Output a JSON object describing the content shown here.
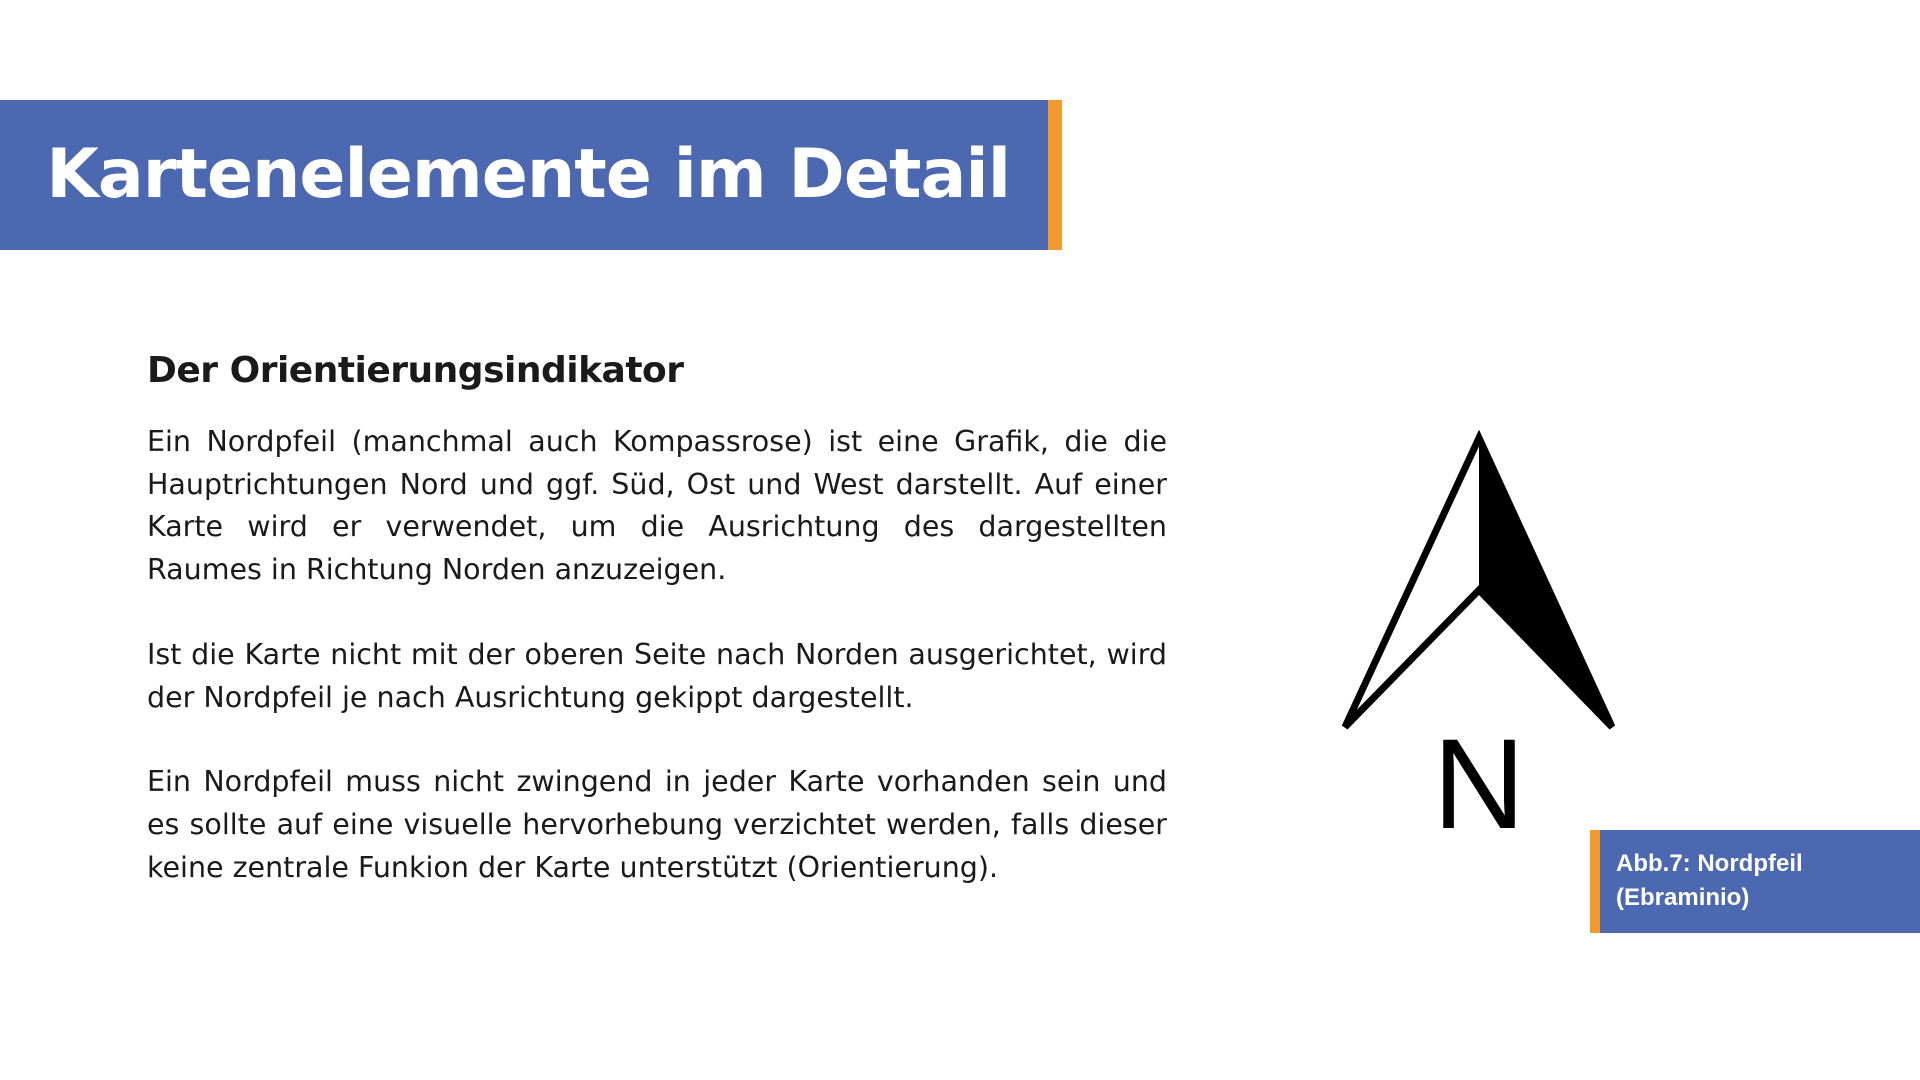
{
  "slide": {
    "title": "Kartenelemente im Detail"
  },
  "content": {
    "heading": "Der Orientierungsindikator",
    "paragraphs": [
      "Ein Nordpfeil (manchmal auch Kompassrose) ist eine Grafik, die die Hauptrichtungen Nord und ggf. Süd, Ost und West darstellt. Auf einer Karte wird er verwendet, um die Ausrichtung des dargestellten Raumes in Richtung Norden anzuzeigen.",
      "Ist die Karte nicht mit der oberen Seite nach Norden ausgerichtet, wird der Nordpfeil je nach Ausrichtung gekippt dargestellt.",
      "Ein Nordpfeil muss nicht zwingend in jeder Karte vorhanden sein und es sollte auf eine visuelle hervorhebung verzichtet werden, falls dieser keine zentrale Funkion der Karte unterstützt (Orientierung)."
    ]
  },
  "figure": {
    "north_letter": "N",
    "icon": "north-arrow-icon",
    "caption_line1": "Abb.7: Nordpfeil",
    "caption_line2": "(Ebraminio)"
  },
  "colors": {
    "title_bar": "#4C68B1",
    "accent": "#F39A2E",
    "text": "#1a1a1a",
    "background": "#ffffff"
  }
}
